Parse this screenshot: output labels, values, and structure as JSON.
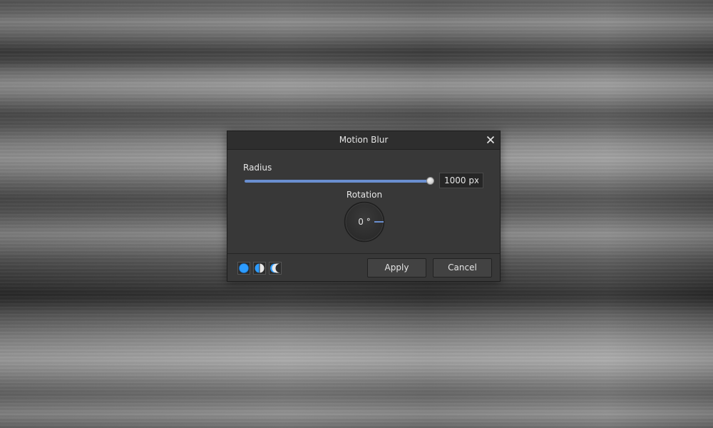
{
  "dialog": {
    "title": "Motion Blur",
    "close_icon": "close-icon"
  },
  "radius": {
    "label": "Radius",
    "value": "1000 px",
    "slider_fraction": 1.0,
    "accent_color": "#6a8fd0"
  },
  "rotation": {
    "label": "Rotation",
    "value": "0 °",
    "angle_degrees": 0
  },
  "footer": {
    "mode_icons": [
      "full-preview-icon",
      "split-preview-icon",
      "mirror-preview-icon"
    ],
    "mode_color": "#2d9cff",
    "apply_label": "Apply",
    "cancel_label": "Cancel"
  }
}
